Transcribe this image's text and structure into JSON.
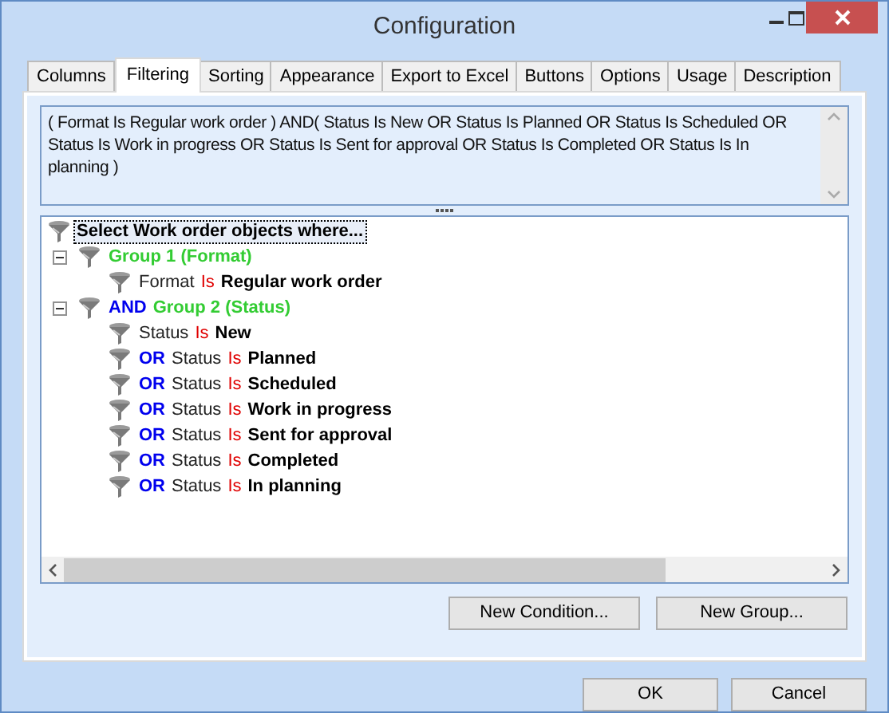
{
  "window": {
    "title": "Configuration"
  },
  "tabs": [
    {
      "label": "Columns",
      "selected": false
    },
    {
      "label": "Filtering",
      "selected": true
    },
    {
      "label": "Sorting",
      "selected": false
    },
    {
      "label": "Appearance",
      "selected": false
    },
    {
      "label": "Export to Excel",
      "selected": false
    },
    {
      "label": "Buttons",
      "selected": false
    },
    {
      "label": "Options",
      "selected": false
    },
    {
      "label": "Usage",
      "selected": false
    },
    {
      "label": "Description",
      "selected": false
    }
  ],
  "expression": "( Format Is Regular work order ) AND( Status Is New OR Status Is Planned OR Status Is Scheduled OR Status Is Work in progress OR Status Is Sent for approval OR Status Is Completed OR Status Is In planning )",
  "tree": {
    "label": "Select Work order objects where...",
    "selected": true,
    "children": [
      {
        "kind": "group",
        "label": "Group 1 (Format)",
        "expanded": true,
        "children": [
          {
            "kind": "condition",
            "field": "Format",
            "operator": "Is",
            "value": "Regular work order"
          }
        ]
      },
      {
        "kind": "group",
        "connector": "AND",
        "label": "Group 2 (Status)",
        "expanded": true,
        "children": [
          {
            "kind": "condition",
            "field": "Status",
            "operator": "Is",
            "value": "New"
          },
          {
            "kind": "condition",
            "connector": "OR",
            "field": "Status",
            "operator": "Is",
            "value": "Planned"
          },
          {
            "kind": "condition",
            "connector": "OR",
            "field": "Status",
            "operator": "Is",
            "value": "Scheduled"
          },
          {
            "kind": "condition",
            "connector": "OR",
            "field": "Status",
            "operator": "Is",
            "value": "Work in progress"
          },
          {
            "kind": "condition",
            "connector": "OR",
            "field": "Status",
            "operator": "Is",
            "value": "Sent for approval"
          },
          {
            "kind": "condition",
            "connector": "OR",
            "field": "Status",
            "operator": "Is",
            "value": "Completed"
          },
          {
            "kind": "condition",
            "connector": "OR",
            "field": "Status",
            "operator": "Is",
            "value": "In planning"
          }
        ]
      }
    ]
  },
  "panel_buttons": [
    "New Condition...",
    "New Group..."
  ],
  "dialog_buttons": [
    "OK",
    "Cancel"
  ]
}
